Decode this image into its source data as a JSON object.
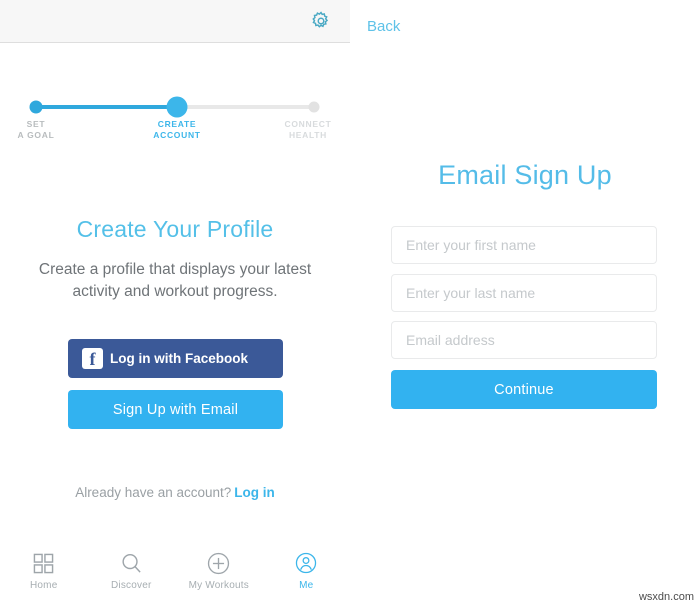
{
  "left": {
    "topbar": {
      "gear_icon": "gear-icon"
    },
    "stepper": {
      "steps": [
        {
          "label_line1": "SET",
          "label_line2": "A GOAL",
          "state": "done"
        },
        {
          "label_line1": "CREATE",
          "label_line2": "ACCOUNT",
          "state": "current"
        },
        {
          "label_line1": "CONNECT",
          "label_line2": "HEALTH",
          "state": "future"
        }
      ]
    },
    "title": "Create Your Profile",
    "description": "Create a profile that displays your latest activity and workout progress.",
    "facebook_button": {
      "label": "Log in with Facebook",
      "icon": "facebook-icon",
      "color": "#3b5998"
    },
    "email_button": {
      "label": "Sign Up with Email",
      "color": "#32b2f0"
    },
    "account_prompt": "Already have an account?",
    "login_link": "Log in",
    "tabs": [
      {
        "label": "Home",
        "icon": "grid-icon",
        "active": false
      },
      {
        "label": "Discover",
        "icon": "search-icon",
        "active": false
      },
      {
        "label": "My Workouts",
        "icon": "plus-circle-icon",
        "active": false
      },
      {
        "label": "Me",
        "icon": "person-circle-icon",
        "active": true
      }
    ]
  },
  "right": {
    "back_label": "Back",
    "title": "Email Sign Up",
    "fields": [
      {
        "placeholder": "Enter your first name",
        "value": ""
      },
      {
        "placeholder": "Enter your last name",
        "value": ""
      },
      {
        "placeholder": "Email address",
        "value": ""
      }
    ],
    "continue_label": "Continue"
  },
  "watermark": "wsxdn.com",
  "colors": {
    "accent": "#3cb6ea",
    "primary_button": "#32b2f0",
    "facebook": "#3b5998",
    "muted_text": "#9aa0a4"
  }
}
